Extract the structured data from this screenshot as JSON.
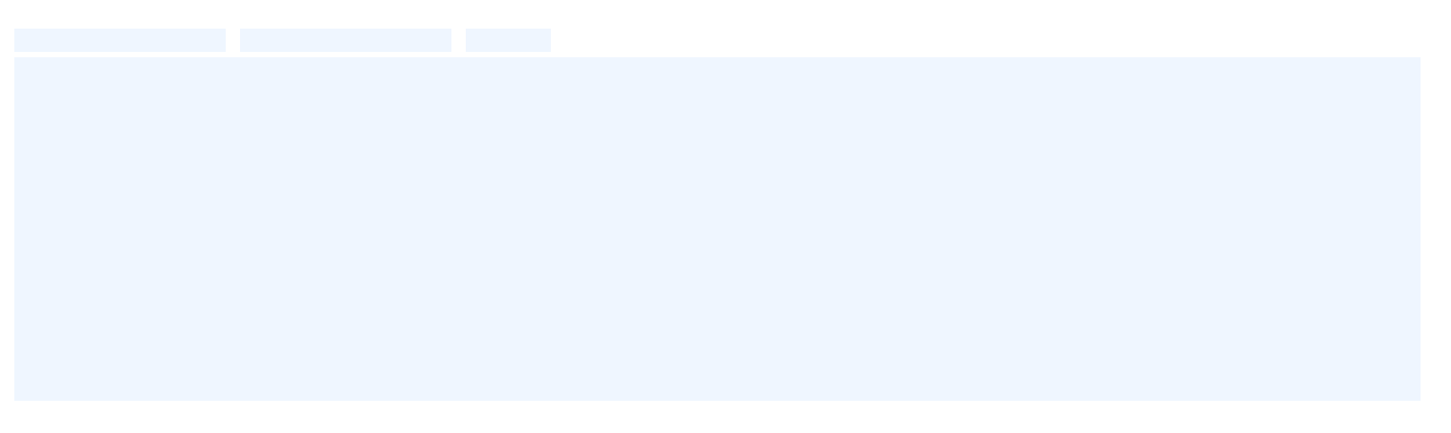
{
  "colors": {
    "background": "#ffffff",
    "placeholder": "#eff6ff"
  },
  "tabs": [
    {
      "label": ""
    },
    {
      "label": ""
    },
    {
      "label": ""
    }
  ],
  "content": {
    "text": ""
  }
}
